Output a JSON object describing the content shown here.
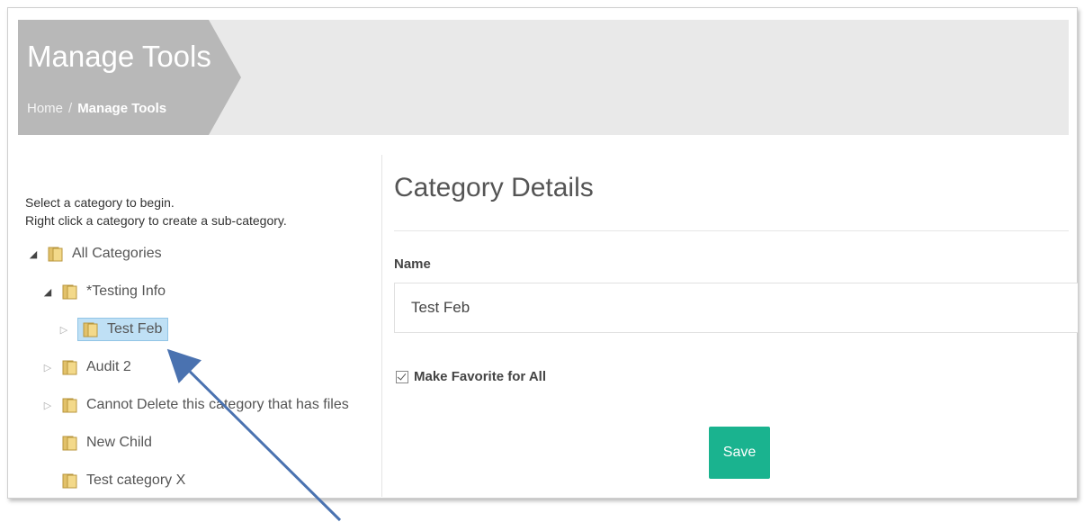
{
  "header": {
    "title": "Manage Tools",
    "breadcrumb": {
      "home": "Home",
      "separator": "/",
      "current": "Manage Tools"
    }
  },
  "left": {
    "instructions": [
      "Select a category to begin.",
      "Right click a category to create a sub-category."
    ],
    "tree": [
      {
        "label": "All Categories",
        "expander": "expanded"
      },
      {
        "label": "*Testing Info",
        "expander": "expanded"
      },
      {
        "label": "Test Feb",
        "expander": "collapsed",
        "selected": true
      },
      {
        "label": "Audit 2",
        "expander": "collapsed"
      },
      {
        "label": "Cannot Delete this category that has files",
        "expander": "collapsed"
      },
      {
        "label": "New Child",
        "expander": "none"
      },
      {
        "label": "Test category X",
        "expander": "none"
      }
    ]
  },
  "details": {
    "title": "Category Details",
    "name_label": "Name",
    "name_value": "Test Feb",
    "favorite_label": "Make Favorite for All",
    "favorite_checked": true,
    "save_label": "Save"
  },
  "colors": {
    "header_bg": "#e9e9e9",
    "title_chevron": "#b8b8b8",
    "selected_bg": "#bfe0f5",
    "save_button": "#1ab38f",
    "annotation_arrow": "#4a72b0"
  },
  "icons": {
    "folder": "folder-icon",
    "expanded": "triangle-down-icon",
    "collapsed": "triangle-right-icon"
  }
}
